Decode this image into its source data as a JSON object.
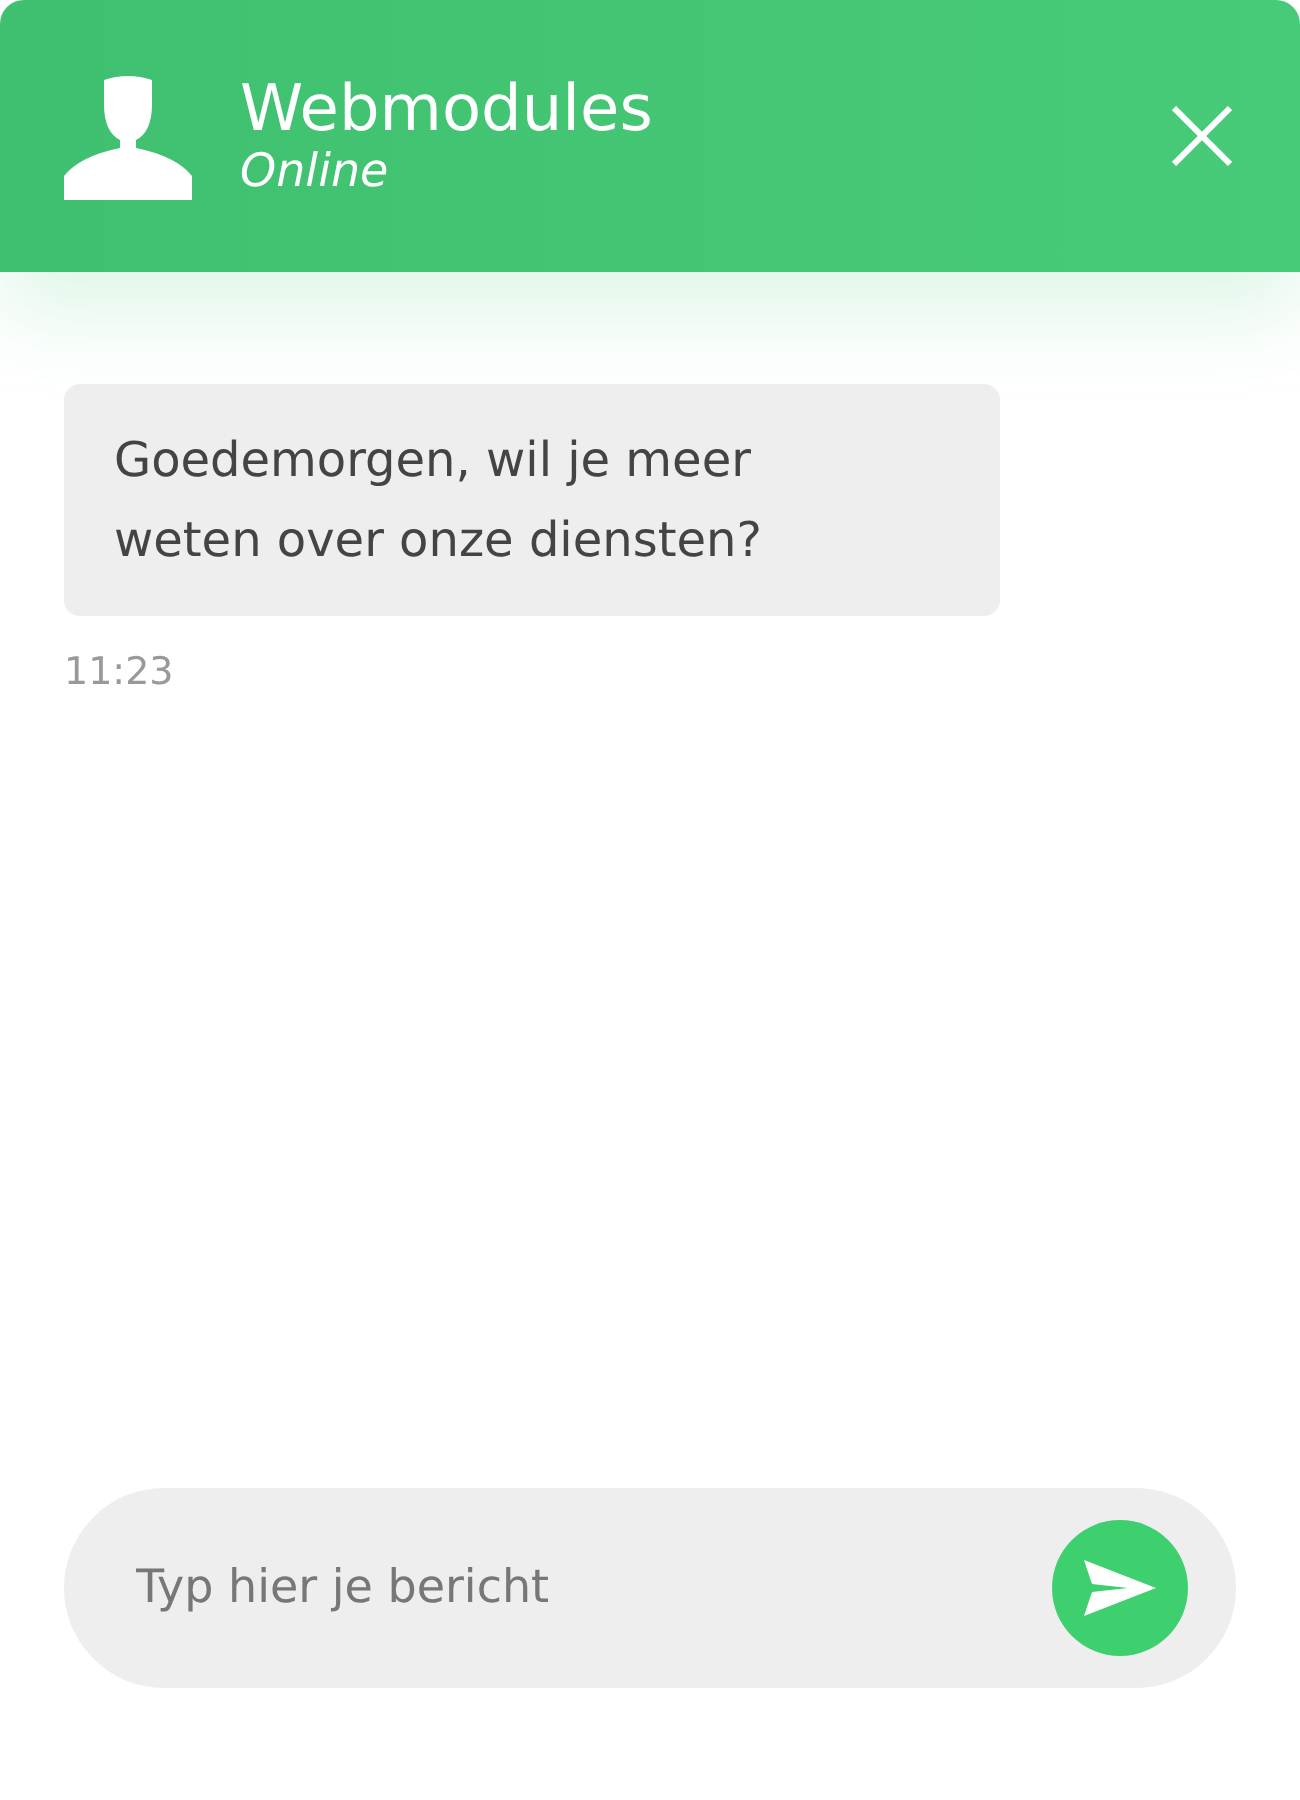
{
  "header": {
    "title": "Webmodules",
    "status": "Online"
  },
  "messages": [
    {
      "text": "Goedemorgen, wil je meer weten over onze diensten?",
      "time": "11:23"
    }
  ],
  "composer": {
    "placeholder": "Typ hier je bericht"
  }
}
